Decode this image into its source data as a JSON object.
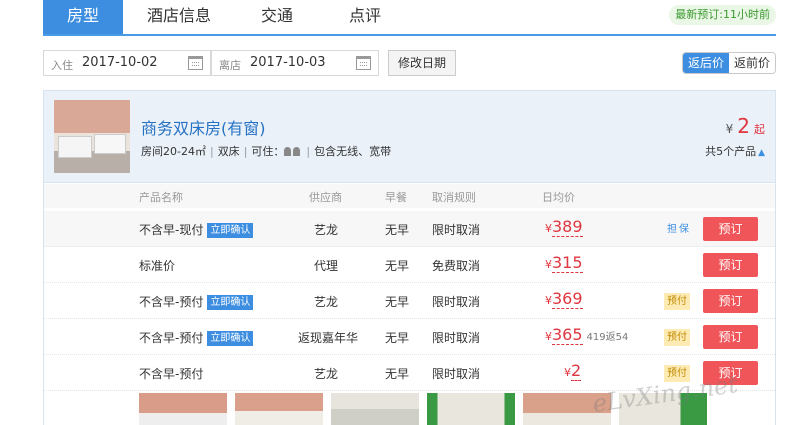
{
  "tabs": [
    {
      "label": "房型",
      "active": true
    },
    {
      "label": "酒店信息",
      "active": false
    },
    {
      "label": "交通",
      "active": false
    },
    {
      "label": "点评",
      "active": false
    }
  ],
  "latest_booking": "最新预订:11小时前",
  "dates": {
    "checkin_label": "入住",
    "checkin_value": "2017-10-02",
    "checkout_label": "离店",
    "checkout_value": "2017-10-03",
    "modify_label": "修改日期"
  },
  "price_toggle": {
    "after_label": "返后价",
    "before_label": "返前价",
    "selected": "返后价"
  },
  "room": {
    "name": "商务双床房(有窗)",
    "area": "房间20-24㎡",
    "bed": "双床",
    "occupancy_label": "可住：",
    "wifi": "包含无线、宽带",
    "price_prefix": "¥",
    "price_value": "2",
    "price_suffix": "起",
    "product_count": "共5个产品",
    "caret": "▲"
  },
  "table": {
    "headers": [
      "产品名称",
      "供应商",
      "早餐",
      "取消规则",
      "日均价"
    ],
    "rows": [
      {
        "name": "不含早-现付",
        "badge": "立即确认",
        "supplier": "艺龙",
        "breakfast": "无早",
        "cancel": "限时取消",
        "price": "389",
        "extra": "",
        "tag": "担保",
        "book": "预订"
      },
      {
        "name": "标准价",
        "badge": "",
        "supplier": "代理",
        "breakfast": "无早",
        "cancel": "免费取消",
        "price": "315",
        "extra": "",
        "tag": "",
        "book": "预订"
      },
      {
        "name": "不含早-预付",
        "badge": "立即确认",
        "supplier": "艺龙",
        "breakfast": "无早",
        "cancel": "限时取消",
        "price": "369",
        "extra": "",
        "tag": "预付",
        "book": "预订"
      },
      {
        "name": "不含早-预付",
        "badge": "立即确认",
        "supplier": "返现嘉年华",
        "breakfast": "无早",
        "cancel": "限时取消",
        "price": "365",
        "extra": "419返54",
        "tag": "预付",
        "book": "预订"
      },
      {
        "name": "不含早-预付",
        "badge": "",
        "supplier": "艺龙",
        "breakfast": "无早",
        "cancel": "限时取消",
        "price": "2",
        "extra": "",
        "tag": "预付",
        "book": "预订"
      }
    ],
    "yen": "¥"
  },
  "watermark": "eLvXing.net"
}
